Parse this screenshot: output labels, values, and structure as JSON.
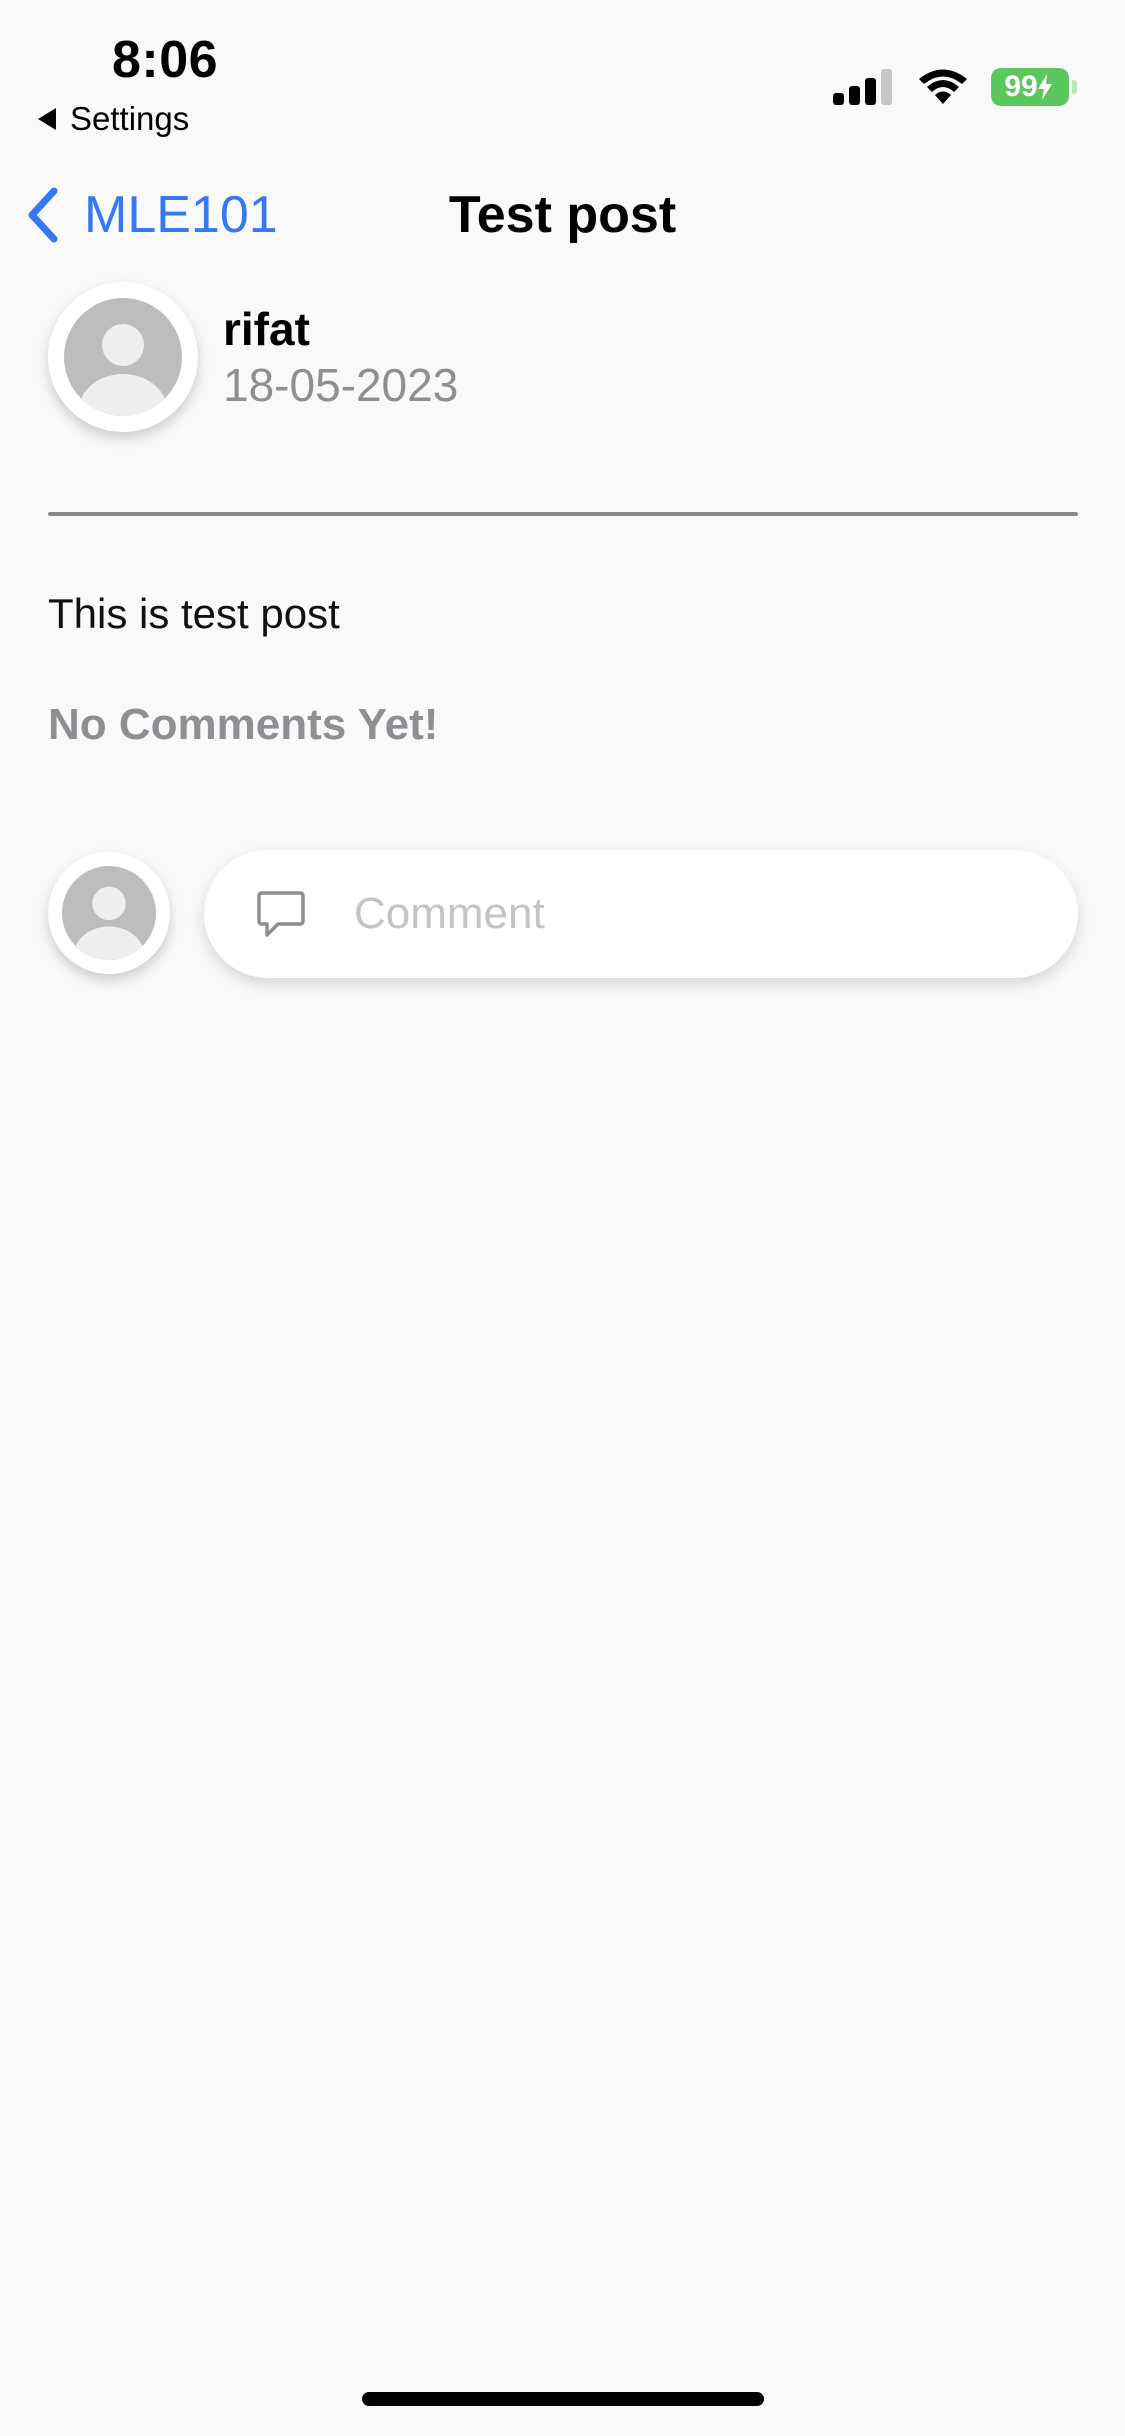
{
  "status_bar": {
    "time": "8:06",
    "back_app": "Settings",
    "battery_level": "99"
  },
  "nav": {
    "back_label": "MLE101",
    "title": "Test post",
    "accent_color": "#3478f6"
  },
  "post": {
    "author": "rifat",
    "date": "18-05-2023",
    "body": "This is test post"
  },
  "comments": {
    "empty_text": "No Comments Yet!",
    "input_placeholder": "Comment",
    "input_value": ""
  },
  "icons": {
    "back": "chevron-left-icon",
    "comment": "speech-bubble-icon",
    "avatar": "user-placeholder-icon"
  }
}
